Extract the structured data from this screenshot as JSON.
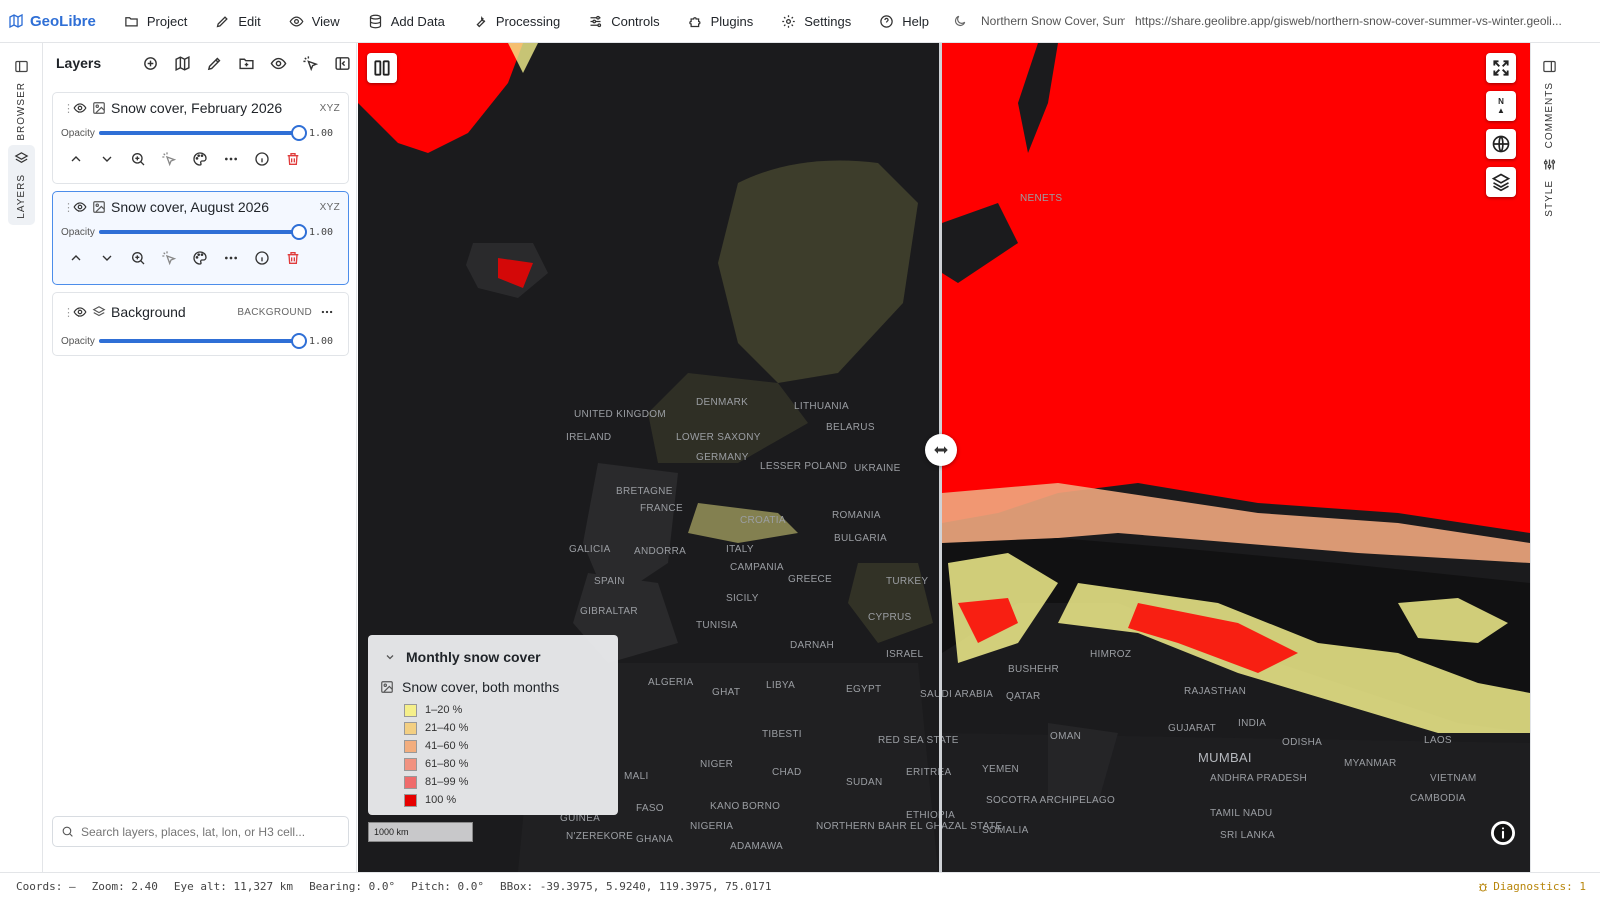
{
  "app": {
    "name": "GeoLibre",
    "project_title": "Northern Snow Cover, Summer vs Winter",
    "share_url": "https://share.geolibre.app/gisweb/northern-snow-cover-summer-vs-winter.geoli..."
  },
  "menu": [
    {
      "label": "Project",
      "icon": "folder-icon"
    },
    {
      "label": "Edit",
      "icon": "pencil-icon"
    },
    {
      "label": "View",
      "icon": "eye-icon"
    },
    {
      "label": "Add Data",
      "icon": "database-icon"
    },
    {
      "label": "Processing",
      "icon": "wrench-icon"
    },
    {
      "label": "Controls",
      "icon": "sliders-icon"
    },
    {
      "label": "Plugins",
      "icon": "puzzle-icon"
    },
    {
      "label": "Settings",
      "icon": "gear-icon"
    },
    {
      "label": "Help",
      "icon": "help-circle-icon"
    }
  ],
  "left_rail": {
    "browser": "BROWSER",
    "layers": "LAYERS"
  },
  "right_rail": {
    "comments": "COMMENTS",
    "style": "STYLE"
  },
  "layers_panel": {
    "title": "Layers",
    "opacity_label": "Opacity",
    "layers": [
      {
        "name": "Snow cover, February 2026",
        "tag": "XYZ",
        "opacity": 1.0,
        "opacity_text": "1.00",
        "selected": false
      },
      {
        "name": "Snow cover, August 2026",
        "tag": "XYZ",
        "opacity": 1.0,
        "opacity_text": "1.00",
        "selected": true
      },
      {
        "name": "Background",
        "tag": "BACKGROUND",
        "opacity": 1.0,
        "opacity_text": "1.00",
        "selected": false
      }
    ],
    "search_placeholder": "Search layers, places, lat, lon, or H3 cell..."
  },
  "map": {
    "labels": [
      "UNITED KINGDOM",
      "IRELAND",
      "DENMARK",
      "LOWER SAXONY",
      "GERMANY",
      "FRANCE",
      "SPAIN",
      "GALICIA",
      "ANDORRA",
      "ITALY",
      "CAMPANIA",
      "SICILY",
      "GIBRALTAR",
      "TUNISIA",
      "ALGERIA",
      "LIBYA",
      "EGYPT",
      "GHAT",
      "TIBESTI",
      "NIGER",
      "CHAD",
      "SUDAN",
      "ERITREA",
      "RED SEA STATE",
      "YEMEN",
      "SAUDI ARABIA",
      "QATAR",
      "OMAN",
      "BUSHEHR",
      "RAJASTHAN",
      "GUJARAT",
      "INDIA",
      "ODISHA",
      "MUMBAI",
      "ANDHRA PRADESH",
      "TAMIL NADU",
      "SRI LANKA",
      "MYANMAR",
      "LAOS",
      "VIETNAM",
      "CAMBODIA",
      "SOMALIA",
      "ETHIOPIA",
      "SOCOTRA ARCHIPELAGO",
      "DARNAH",
      "ISRAEL",
      "CYPRUS",
      "TURKEY",
      "GREECE",
      "BULGARIA",
      "ROMANIA",
      "CROATIA",
      "UKRAINE",
      "BELARUS",
      "LITHUANIA",
      "LESSER POLAND",
      "NIGERIA",
      "KANO",
      "BORNO",
      "GUINEA",
      "N'ZEREKORE",
      "GHANA",
      "NORTHERN BAHR EL GHAZAL STATE",
      "FASO",
      "MALI",
      "BRETAGNE",
      "NENETS",
      "ADAMAWA",
      "HIMROZ"
    ],
    "legend": {
      "title": "Monthly snow cover",
      "layer_name": "Snow cover, both months",
      "items": [
        {
          "label": "1–20 %",
          "color": "#f5ef8a"
        },
        {
          "label": "21–40 %",
          "color": "#f3cf82"
        },
        {
          "label": "41–60 %",
          "color": "#f2ad7e"
        },
        {
          "label": "61–80 %",
          "color": "#f19280"
        },
        {
          "label": "81–99 %",
          "color": "#ef6b6b"
        },
        {
          "label": "100 %",
          "color": "#e60000"
        }
      ]
    },
    "scale": "1000 km"
  },
  "status": {
    "coords": "Coords: —",
    "zoom": "Zoom: 2.40",
    "eye_alt": "Eye alt: 11,327 km",
    "bearing": "Bearing: 0.0°",
    "pitch": "Pitch: 0.0°",
    "bbox": "BBox: -39.3975, 5.9240, 119.3975, 75.0171",
    "diagnostics": "Diagnostics: 1"
  },
  "colors": {
    "accent": "#2f6fd6",
    "snow_full": "#ff0000",
    "snow_low": "#f2ef8c",
    "map_bg": "#1b1b1d"
  }
}
